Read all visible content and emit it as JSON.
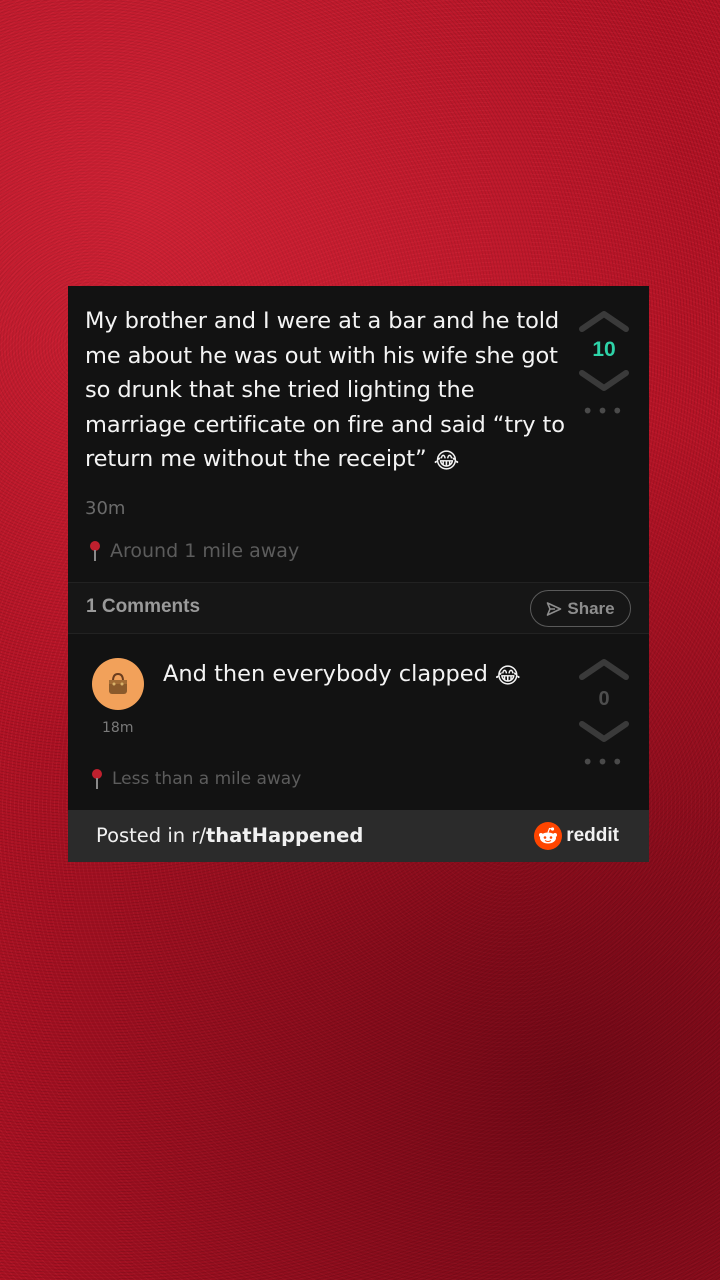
{
  "post": {
    "text": "My brother and I were at a bar and he told me about he was out with his wife she got so drunk that she tried lighting the marriage certificate on fire and said “try to return me without the receipt”",
    "emoji": "😂",
    "score": "10",
    "timestamp": "30m",
    "location": "Around 1 mile away"
  },
  "comments_bar": {
    "count_label": "1 Comments",
    "share_label": "Share"
  },
  "comment": {
    "text": "And then everybody clapped",
    "emoji": "😂",
    "time": "18m",
    "score": "0",
    "location": "Less than a mile away"
  },
  "footer": {
    "posted_prefix": "Posted in r/",
    "subreddit": "thatHappened",
    "brand": "reddit"
  },
  "colors": {
    "score_accent": "#2ed3a8",
    "background": "#b01224",
    "reddit_orange": "#ff4500"
  },
  "icons": [
    "upvote-chevron-icon",
    "downvote-chevron-icon",
    "more-dots-icon",
    "location-pin-icon",
    "share-send-icon",
    "avatar-handbag-icon",
    "reddit-logo-icon"
  ]
}
